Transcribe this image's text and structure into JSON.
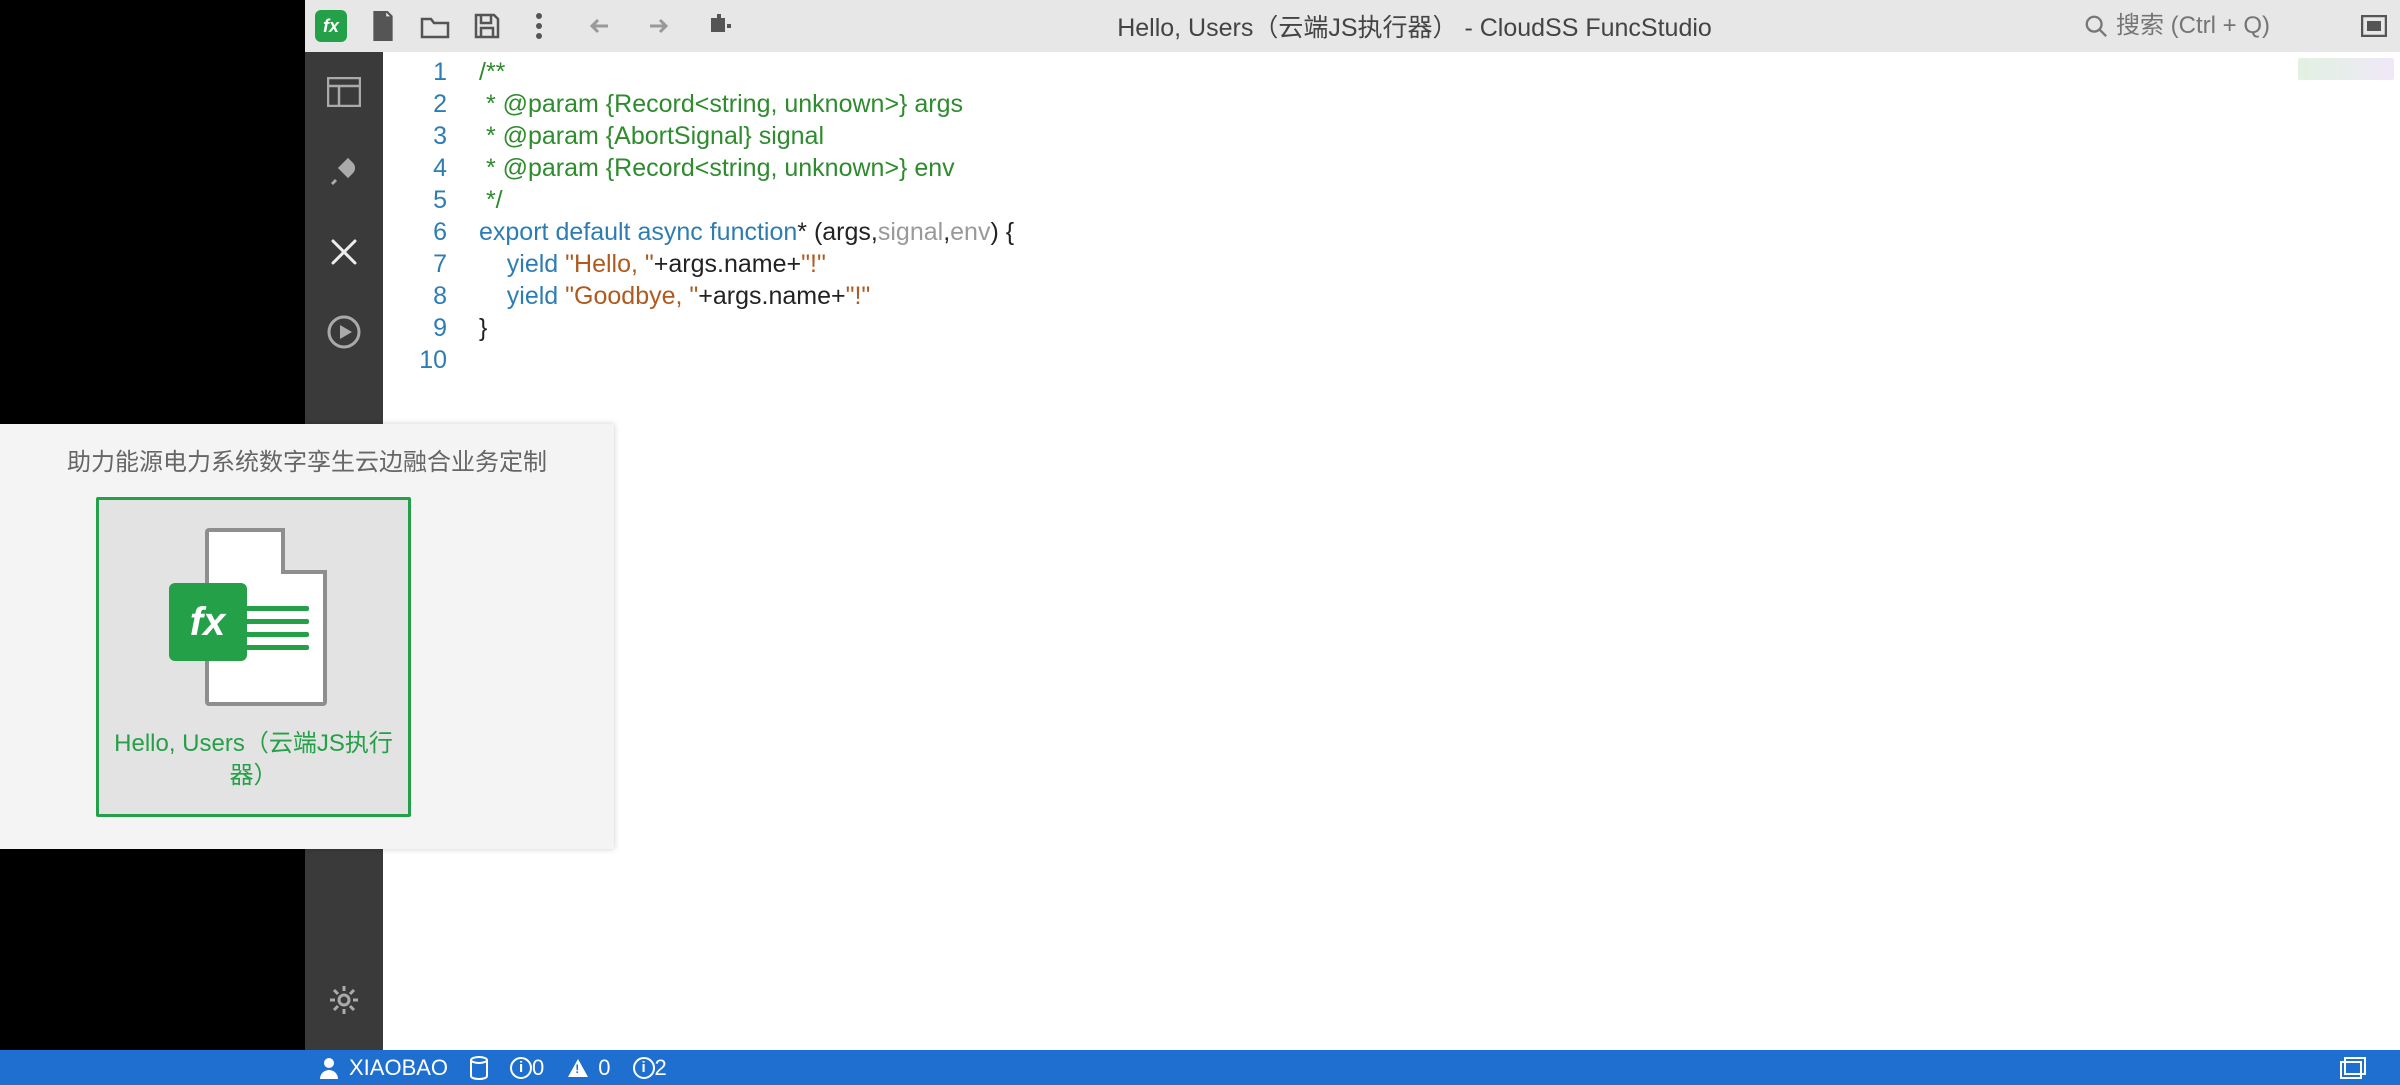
{
  "toolbar": {
    "title": "Hello, Users（云端JS执行器） - CloudSS FuncStudio",
    "search_placeholder": "搜索 (Ctrl + Q)",
    "logo_letters": "fx"
  },
  "siderail": {
    "items": [
      "overview",
      "plug",
      "tools",
      "run"
    ],
    "bottom": "settings",
    "active_index": 2
  },
  "editor": {
    "line_numbers": [
      "1",
      "2",
      "3",
      "4",
      "5",
      "6",
      "7",
      "8",
      "9",
      "10"
    ],
    "highlight_line_index": 8,
    "lines": [
      {
        "type": "comment",
        "text": "/**"
      },
      {
        "type": "comment",
        "text": " * @param {Record<string, unknown>} args"
      },
      {
        "type": "comment",
        "text": " * @param {AbortSignal} signal"
      },
      {
        "type": "comment",
        "text": " * @param {Record<string, unknown>} env"
      },
      {
        "type": "comment",
        "text": " */"
      },
      {
        "type": "mixed",
        "segments": [
          {
            "cls": "c-key",
            "t": "export "
          },
          {
            "cls": "c-key",
            "t": "default "
          },
          {
            "cls": "c-key",
            "t": "async "
          },
          {
            "cls": "c-key",
            "t": "function"
          },
          {
            "cls": "c-plain",
            "t": "* ("
          },
          {
            "cls": "c-plain",
            "t": "args,"
          },
          {
            "cls": "c-dim",
            "t": "signal"
          },
          {
            "cls": "c-plain",
            "t": ","
          },
          {
            "cls": "c-dim",
            "t": "env"
          },
          {
            "cls": "c-plain",
            "t": ") {"
          }
        ]
      },
      {
        "type": "mixed",
        "segments": [
          {
            "cls": "c-plain",
            "t": "    "
          },
          {
            "cls": "c-key",
            "t": "yield "
          },
          {
            "cls": "c-str",
            "t": "\"Hello, \""
          },
          {
            "cls": "c-plain",
            "t": "+args.name+"
          },
          {
            "cls": "c-str",
            "t": "\"!\""
          }
        ]
      },
      {
        "type": "mixed",
        "segments": [
          {
            "cls": "c-plain",
            "t": "    "
          },
          {
            "cls": "c-key",
            "t": "yield "
          },
          {
            "cls": "c-str",
            "t": "\"Goodbye, \""
          },
          {
            "cls": "c-plain",
            "t": "+args.name+"
          },
          {
            "cls": "c-str",
            "t": "\"!\""
          }
        ]
      },
      {
        "type": "plain",
        "text": "}"
      },
      {
        "type": "plain",
        "text": ""
      }
    ]
  },
  "popup": {
    "subtitle": "助力能源电力系统数字孪生云边融合业务定制",
    "card_label": "Hello, Users（云端JS执行器）",
    "fx": "fx"
  },
  "statusbar": {
    "user": "XIAOBAO",
    "info_count": "0",
    "warn_count": "0",
    "hint_count": "2"
  }
}
